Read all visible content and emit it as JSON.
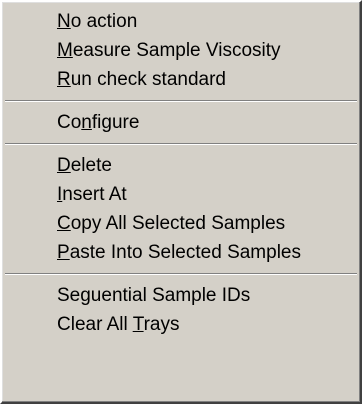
{
  "menu": {
    "items": [
      {
        "pre": "",
        "ul": "N",
        "post": "o action"
      },
      {
        "pre": "",
        "ul": "M",
        "post": "easure Sample Viscosity"
      },
      {
        "pre": "",
        "ul": "R",
        "post": "un check standard"
      },
      {
        "pre": "Co",
        "ul": "n",
        "post": "figure"
      },
      {
        "pre": "",
        "ul": "D",
        "post": "elete"
      },
      {
        "pre": "",
        "ul": "I",
        "post": "nsert At"
      },
      {
        "pre": "",
        "ul": "C",
        "post": "opy All Selected Samples"
      },
      {
        "pre": "",
        "ul": "P",
        "post": "aste Into Selected Samples"
      },
      {
        "pre": "Seguential Sample IDs",
        "ul": "",
        "post": ""
      },
      {
        "pre": "Clear All ",
        "ul": "T",
        "post": "rays"
      }
    ]
  }
}
